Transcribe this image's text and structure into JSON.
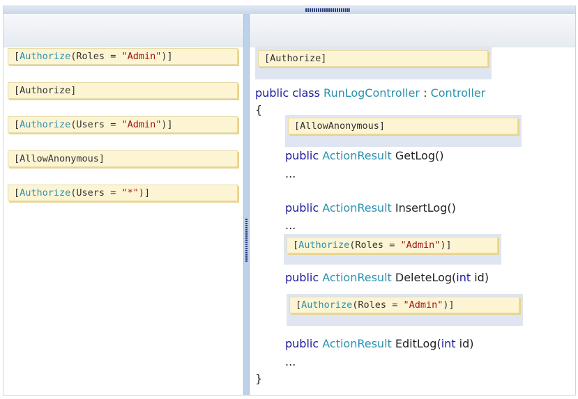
{
  "left_tiles": [
    {
      "attr_open": "[",
      "name": "Authorize",
      "args_pre": "(Roles = ",
      "str": "\"Admin\"",
      "args_post": ")]"
    },
    {
      "plain": "[Authorize]"
    },
    {
      "attr_open": "[",
      "name": "Authorize",
      "args_pre": "(Users = ",
      "str": "\"Admin\"",
      "args_post": ")]"
    },
    {
      "plain": "[AllowAnonymous]"
    },
    {
      "attr_open": "[",
      "name": "Authorize",
      "args_pre": "(Users = ",
      "str": "\"*\"",
      "args_post": ")]"
    }
  ],
  "right_slots": [
    {
      "plain": "[Authorize]"
    },
    {
      "plain": "[AllowAnonymous]"
    },
    {
      "attr_open": "[",
      "name": "Authorize",
      "args_pre": "(Roles = ",
      "str": "\"Admin\"",
      "args_post": ")]"
    },
    {
      "attr_open": "[",
      "name": "Authorize",
      "args_pre": "(Roles = ",
      "str": "\"Admin\"",
      "args_post": ")]"
    }
  ],
  "code": {
    "kw_public": "public",
    "kw_class": "class",
    "class_name": "RunLogController",
    "colon": ":",
    "base_class": "Controller",
    "open_brace": "{",
    "close_brace": "}",
    "type_action": "ActionResult",
    "method1": "GetLog()",
    "method2": "InsertLog()",
    "method3_pre": "DeleteLog(",
    "kw_int": "int",
    "method3_post": " id)",
    "method4_pre": "EditLog(",
    "method4_post": " id)",
    "ellipsis": "..."
  }
}
